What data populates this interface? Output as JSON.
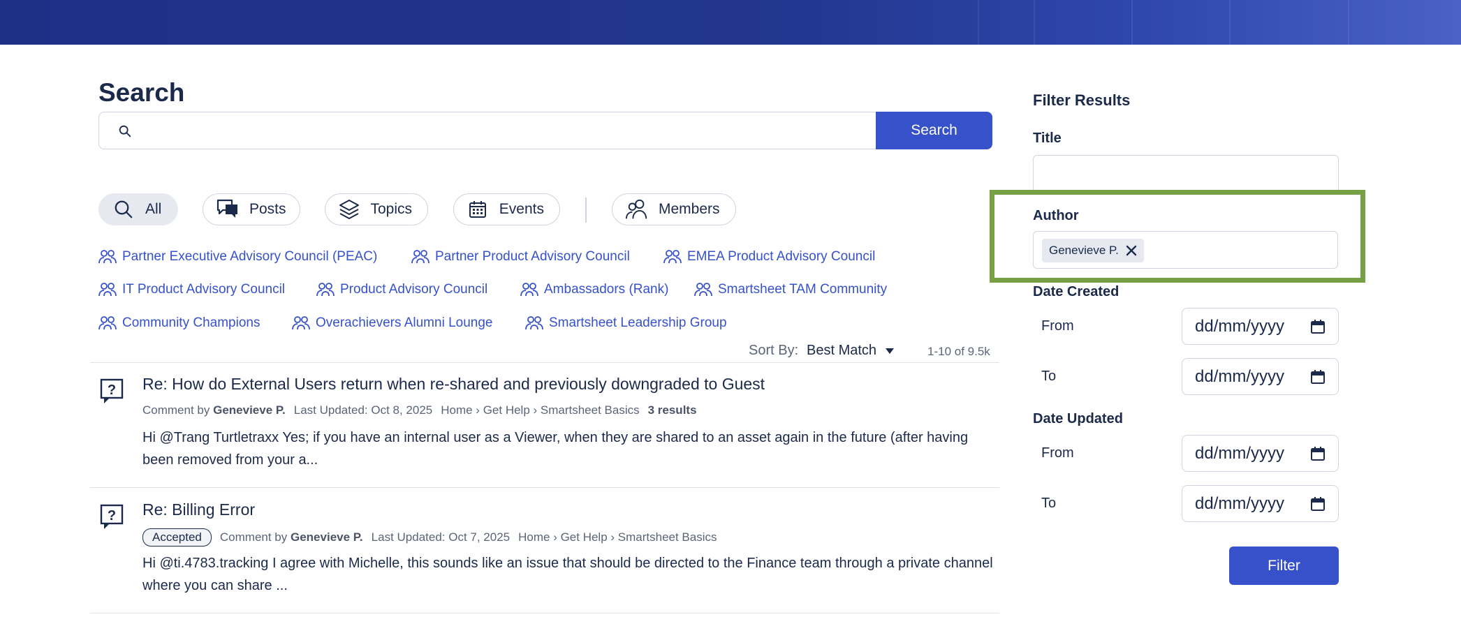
{
  "search": {
    "title": "Search",
    "query": "",
    "placeholder": "",
    "button_label": "Search"
  },
  "type_filters": [
    {
      "label": "All",
      "icon": "search-icon",
      "active": true
    },
    {
      "label": "Posts",
      "icon": "posts-icon",
      "active": false
    },
    {
      "label": "Topics",
      "icon": "topics-icon",
      "active": false
    },
    {
      "label": "Events",
      "icon": "calendar-icon",
      "active": false
    },
    {
      "label": "Members",
      "icon": "members-icon",
      "active": false
    }
  ],
  "groups": [
    "Partner Executive Advisory Council (PEAC)",
    "Partner Product Advisory Council",
    "EMEA Product Advisory Council",
    "IT Product Advisory Council",
    "Product Advisory Council",
    "Ambassadors (Rank)",
    "Smartsheet TAM Community",
    "Community Champions",
    "Overachievers Alumni Lounge",
    "Smartsheet Leadership Group"
  ],
  "sort": {
    "label": "Sort By:",
    "value": "Best Match",
    "count": "1-10 of 9.5k"
  },
  "results": [
    {
      "title": "Re: How do External Users return when re-shared and previously downgraded to Guest",
      "badge": "",
      "type_label": "Comment by",
      "author": "Genevieve P.",
      "updated": "Last Updated: Oct 8, 2025",
      "breadcrumb": "Home › Get Help › Smartsheet Basics",
      "extra": "3 results",
      "snippet": "Hi @Trang Turtletraxx Yes; if you have an internal user as a Viewer, when they are shared to an asset again in the future (after having been removed from your a..."
    },
    {
      "title": "Re: Billing Error",
      "badge": "Accepted",
      "type_label": "Comment by",
      "author": "Genevieve P.",
      "updated": "Last Updated: Oct 7, 2025",
      "breadcrumb": "Home › Get Help › Smartsheet Basics",
      "extra": "",
      "snippet": "Hi @ti.4783.tracking I agree with Michelle, this sounds like an issue that should be directed to the Finance team through a private channel where you can share ..."
    }
  ],
  "filters": {
    "heading": "Filter Results",
    "title_label": "Title",
    "title_value": "",
    "author_label": "Author",
    "author_token": "Genevieve P.",
    "date_created_label": "Date Created",
    "date_updated_label": "Date Updated",
    "from_label": "From",
    "to_label": "To",
    "date_placeholder": "dd/mm/yyyy",
    "button_label": "Filter"
  },
  "colors": {
    "accent": "#3651c9",
    "link": "#3651c9",
    "highlight": "#76a044",
    "banner": "#22378f"
  }
}
